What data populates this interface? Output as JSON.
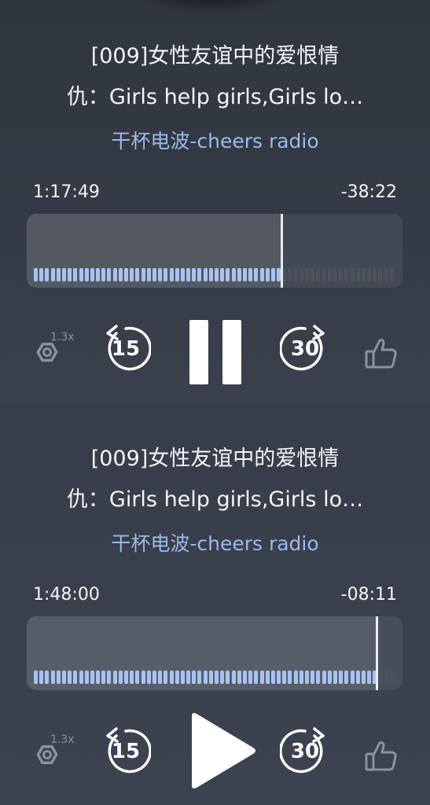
{
  "players": [
    {
      "title_line1": "[009]女性友谊中的爱恨情",
      "title_line2": "仇：Girls help girls,Girls lo…",
      "author": "干杯电波-cheers radio",
      "elapsed": "1:17:49",
      "remaining": "-38:22",
      "progress": 0.677,
      "speed": "1.3x",
      "rewind_seconds": "15",
      "forward_seconds": "30",
      "state": "playing",
      "center_icon": "pause-icon"
    },
    {
      "title_line1": "[009]女性友谊中的爱恨情",
      "title_line2": "仇：Girls help girls,Girls lo…",
      "author": "干杯电波-cheers radio",
      "elapsed": "1:48:00",
      "remaining": "-08:11",
      "progress": 0.93,
      "speed": "1.3x",
      "rewind_seconds": "15",
      "forward_seconds": "30",
      "state": "paused",
      "center_icon": "play-icon"
    }
  ],
  "colors": {
    "accent": "#9db8ea",
    "played_bar": "#a9c2f0",
    "unplayed_bar": "#4b525c",
    "icon_muted": "#8a929c"
  }
}
